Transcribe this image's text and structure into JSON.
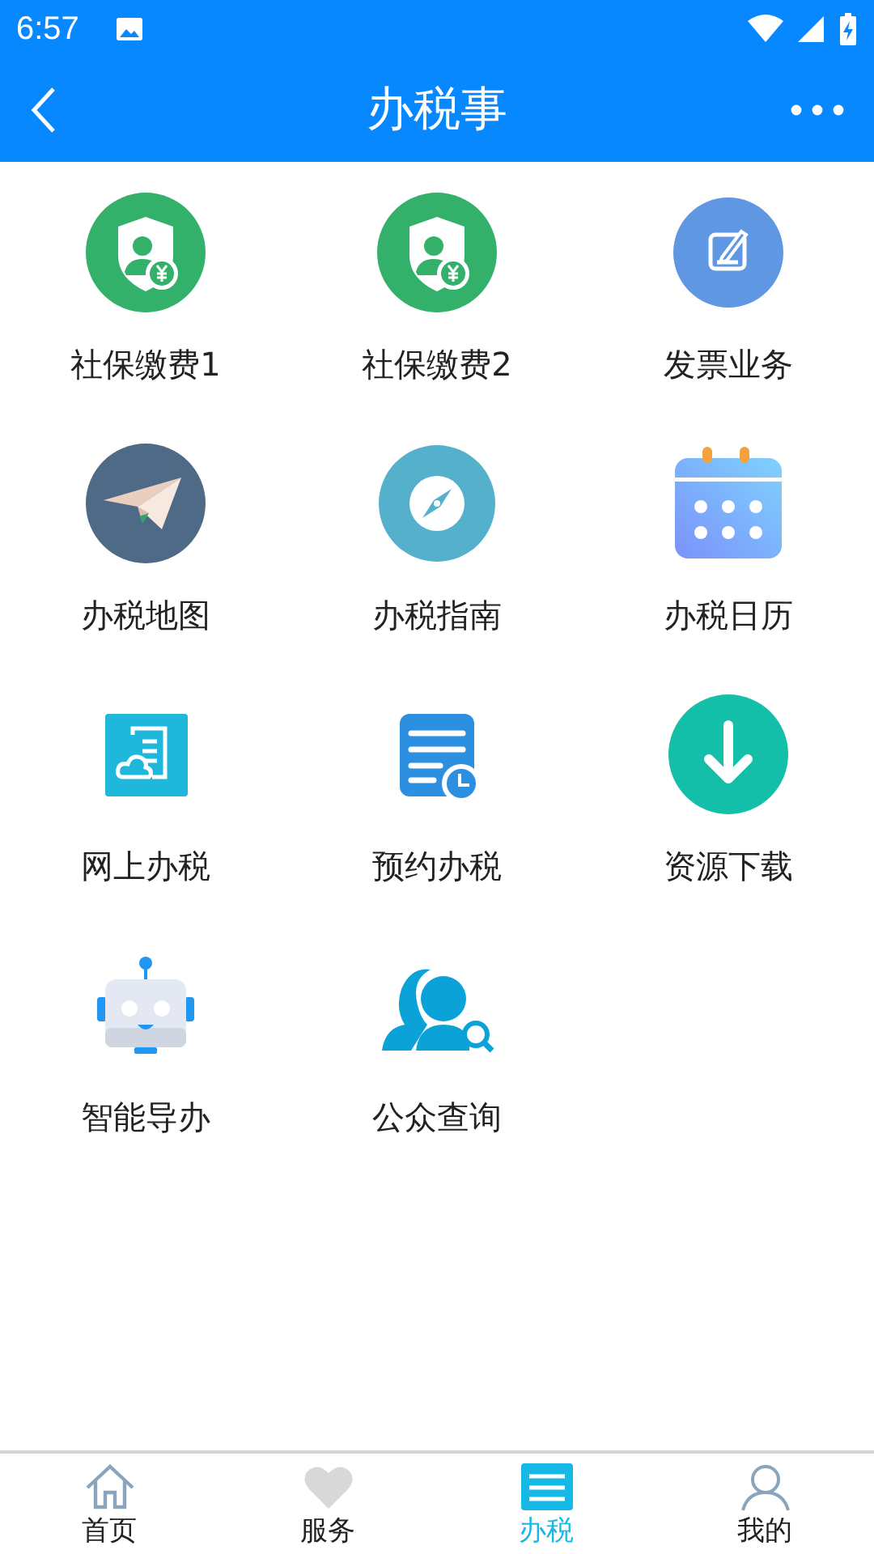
{
  "status_bar": {
    "time": "6:57"
  },
  "app_bar": {
    "title": "办税事"
  },
  "grid": [
    {
      "label": "社保缴费1",
      "kind": "shield"
    },
    {
      "label": "社保缴费2",
      "kind": "shield"
    },
    {
      "label": "发票业务",
      "kind": "edit"
    },
    {
      "label": "办税地图",
      "kind": "plane"
    },
    {
      "label": "办税指南",
      "kind": "compass"
    },
    {
      "label": "办税日历",
      "kind": "calendar"
    },
    {
      "label": "网上办税",
      "kind": "cloud"
    },
    {
      "label": "预约办税",
      "kind": "doc"
    },
    {
      "label": "资源下载",
      "kind": "download"
    },
    {
      "label": "智能导办",
      "kind": "robot"
    },
    {
      "label": "公众查询",
      "kind": "people"
    }
  ],
  "bottom_nav": [
    {
      "label": "首页",
      "kind": "home",
      "selected": false
    },
    {
      "label": "服务",
      "kind": "heart",
      "selected": false
    },
    {
      "label": "办税",
      "kind": "list",
      "selected": true
    },
    {
      "label": "我的",
      "kind": "person",
      "selected": false
    }
  ]
}
